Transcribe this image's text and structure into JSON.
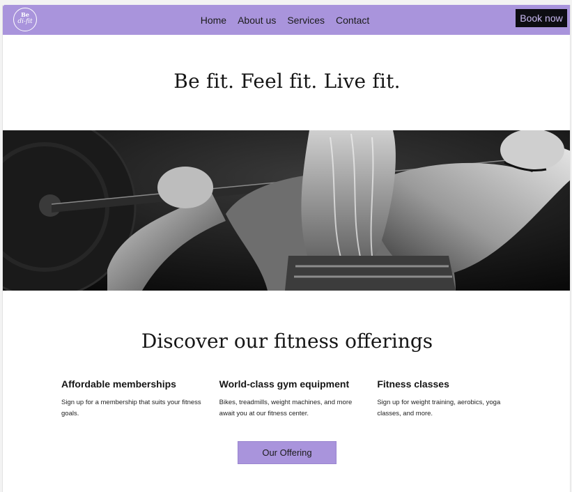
{
  "brand": {
    "logo_top": "Be",
    "logo_bottom": "di-fit"
  },
  "nav": {
    "items": [
      {
        "label": "Home"
      },
      {
        "label": "About us"
      },
      {
        "label": "Services"
      },
      {
        "label": "Contact"
      }
    ],
    "book_label": "Book now"
  },
  "hero": {
    "title": "Be fit. Feel fit. Live fit.",
    "image_alt": "Black and white photo of a woman lifting a barbell across her shoulders"
  },
  "offerings": {
    "title": "Discover our fitness offerings",
    "items": [
      {
        "title": "Affordable memberships",
        "description": "Sign up for a membership that suits your fitness goals."
      },
      {
        "title": "World-class gym equipment",
        "description": "Bikes, treadmills, weight machines, and more await you at our fitness center."
      },
      {
        "title": "Fitness classes",
        "description": "Sign up for weight training, aerobics, yoga classes, and more."
      }
    ],
    "cta_label": "Our Offering"
  },
  "colors": {
    "accent": "#a994dc",
    "dark_button": "#0d0d12",
    "dark_button_text": "#c9b9f2"
  }
}
